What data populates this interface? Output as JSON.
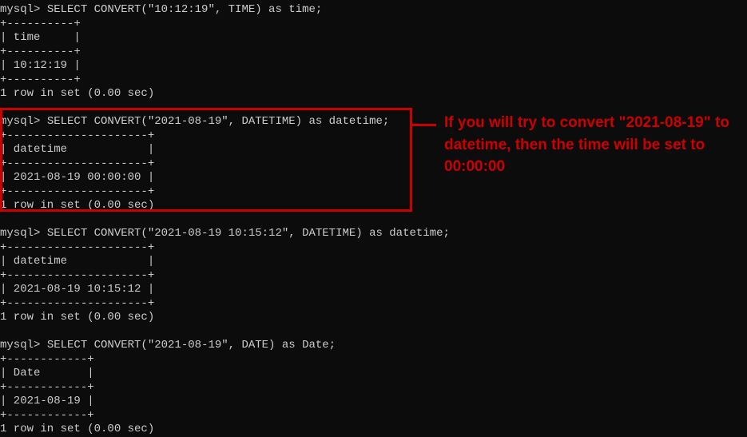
{
  "blocks": [
    {
      "prompt": "mysql> ",
      "query": "SELECT CONVERT(\"10:12:19\", TIME) as time;",
      "sep_short": "+----------+",
      "header_row": "| time     |",
      "value_row": "| 10:12:19 |",
      "footer": "1 row in set (0.00 sec)"
    },
    {
      "prompt": "mysql> ",
      "query": "SELECT CONVERT(\"2021-08-19\", DATETIME) as datetime;",
      "sep": "+---------------------+",
      "header_row": "| datetime            |",
      "value_row": "| 2021-08-19 00:00:00 |",
      "footer": "1 row in set (0.00 sec)"
    },
    {
      "prompt": "mysql> ",
      "query": "SELECT CONVERT(\"2021-08-19 10:15:12\", DATETIME) as datetime;",
      "sep": "+---------------------+",
      "header_row": "| datetime            |",
      "value_row": "| 2021-08-19 10:15:12 |",
      "footer": "1 row in set (0.00 sec)"
    },
    {
      "prompt": "mysql> ",
      "query": "SELECT CONVERT(\"2021-08-19\", DATE) as Date;",
      "sep": "+------------+",
      "header_row": "| Date       |",
      "value_row": "| 2021-08-19 |",
      "footer": "1 row in set (0.00 sec)"
    }
  ],
  "annotation": "If you will try to convert \"2021-08-19\" to datetime, then the time will be set to 00:00:00"
}
